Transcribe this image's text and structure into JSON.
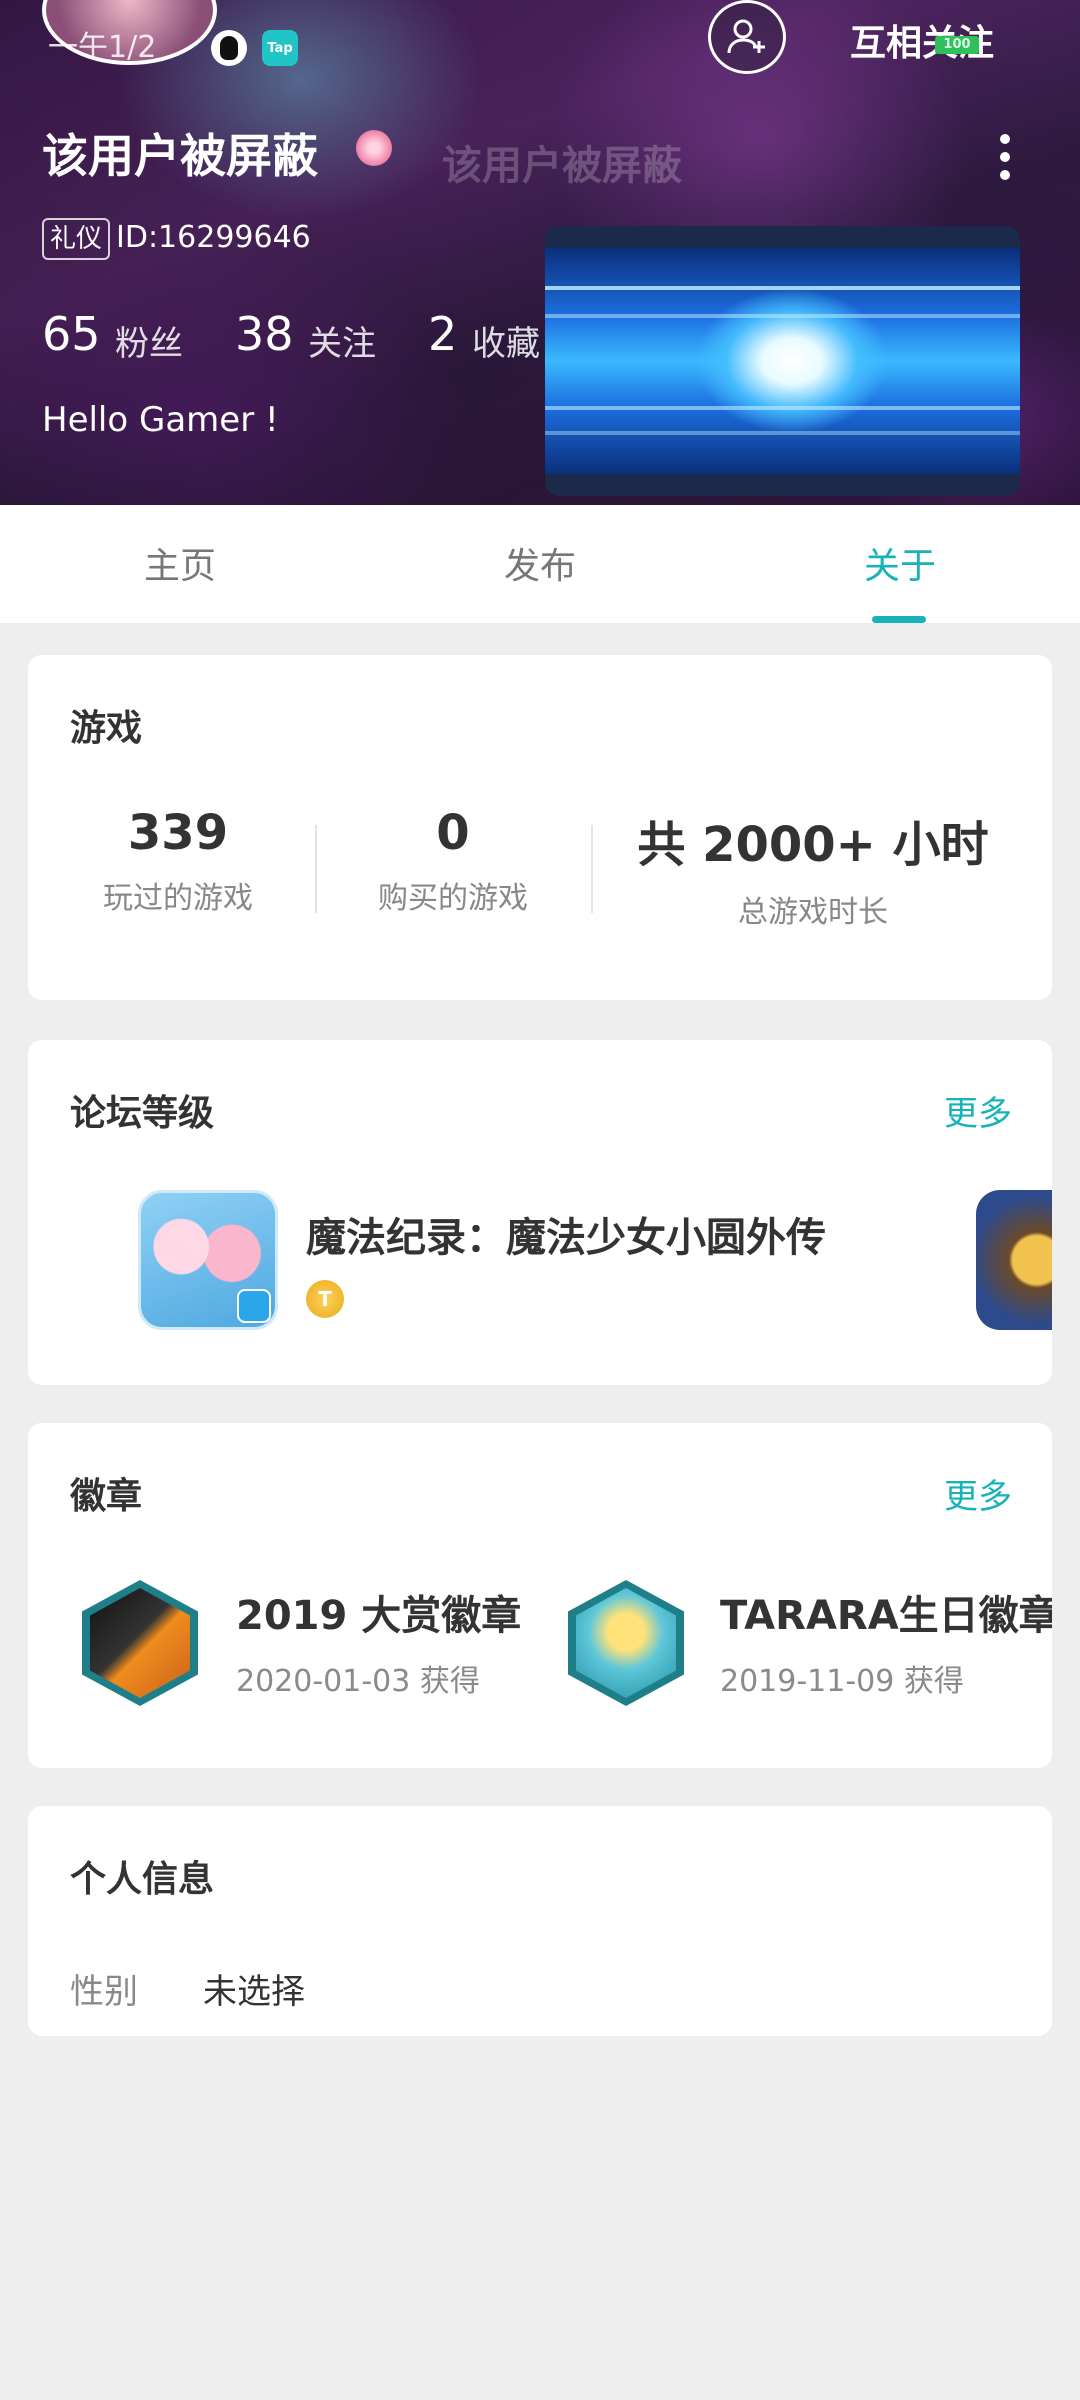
{
  "header": {
    "avatar_text": "一午1/2",
    "follow_label": "互相关注",
    "level_badge": "100",
    "username": "该用户被屏蔽",
    "ghost_name": "该用户被屏蔽",
    "etiquette_tag": "礼仪",
    "user_id": "ID:16299646",
    "stats": [
      {
        "num": "65",
        "label": "粉丝"
      },
      {
        "num": "38",
        "label": "关注"
      },
      {
        "num": "2",
        "label": "收藏"
      }
    ],
    "bio": "Hello Gamer !",
    "tap_icon_text": "Tap"
  },
  "tabs": [
    {
      "label": "主页",
      "active": false
    },
    {
      "label": "发布",
      "active": false
    },
    {
      "label": "关于",
      "active": true
    }
  ],
  "games_card": {
    "title": "游戏",
    "stats": [
      {
        "value": "339",
        "label": "玩过的游戏"
      },
      {
        "value": "0",
        "label": "购买的游戏"
      },
      {
        "value": "共 2000+ 小时",
        "label": "总游戏时长"
      }
    ]
  },
  "forum_card": {
    "title": "论坛等级",
    "more": "更多",
    "game_name": "魔法纪录：魔法少女小圆外传",
    "badge_letter": "T"
  },
  "badges_card": {
    "title": "徽章",
    "more": "更多",
    "items": [
      {
        "name": "2019 大赏徽章",
        "date": "2020-01-03 获得"
      },
      {
        "name": "TARARA生日徽章",
        "date": "2019-11-09 获得"
      }
    ]
  },
  "info_card": {
    "title": "个人信息",
    "gender_label": "性别",
    "gender_value": "未选择"
  },
  "colors": {
    "accent": "#17b3b8",
    "background": "#eeeeef"
  },
  "icons": [
    "qq-icon",
    "tap-icon",
    "add-friend-icon",
    "more-vertical-icon",
    "pink-badge-icon",
    "bilibili-icon",
    "t-level-badge-icon"
  ]
}
